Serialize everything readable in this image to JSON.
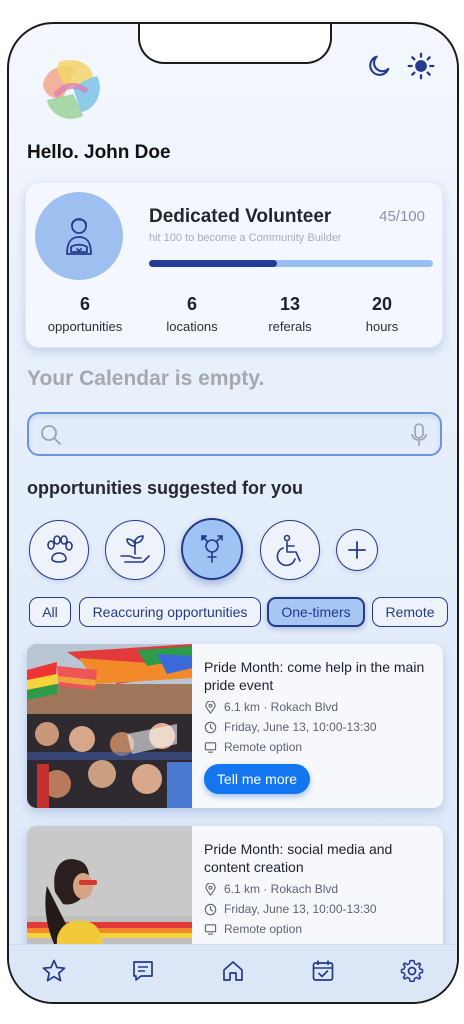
{
  "greeting": "Hello. John Doe",
  "profile": {
    "level_title": "Dedicated Volunteer",
    "points": "45/100",
    "next_level_hint": "hit 100 to become a Community Builder",
    "progress_fraction": 0.45,
    "avatar_icon": "volunteer-person-icon"
  },
  "stats": [
    {
      "value": "6",
      "label": "opportunities"
    },
    {
      "value": "6",
      "label": "locations"
    },
    {
      "value": "13",
      "label": "referals"
    },
    {
      "value": "20",
      "label": "hours"
    }
  ],
  "calendar_message": "Your Calendar is empty.",
  "search": {
    "placeholder": "",
    "value": ""
  },
  "suggested_title": "opportunities suggested for you",
  "categories": [
    {
      "icon": "paw-icon",
      "active": false
    },
    {
      "icon": "plant-hand-icon",
      "active": false
    },
    {
      "icon": "gender-symbol-icon",
      "active": true
    },
    {
      "icon": "accessibility-icon",
      "active": false
    },
    {
      "icon": "plus-icon",
      "active": false
    }
  ],
  "filters": [
    {
      "label": "All",
      "active": false
    },
    {
      "label": "Reaccuring opportunities",
      "active": false
    },
    {
      "label": "One-timers",
      "active": true
    },
    {
      "label": "Remote",
      "active": false
    }
  ],
  "opportunities": [
    {
      "title": "Pride Month: come help in the main pride event",
      "distance": "6.1 km · Rokach Blvd",
      "date": "Friday, June 13, 10:00-13:30",
      "remote": "Remote option",
      "cta": "Tell me more"
    },
    {
      "title": "Pride Month: social media and content creation",
      "distance": "6.1 km · Rokach Blvd",
      "date": "Friday, June 13, 10:00-13:30",
      "remote": "Remote option"
    }
  ],
  "nav": [
    {
      "icon": "star-icon"
    },
    {
      "icon": "chat-icon"
    },
    {
      "icon": "home-icon"
    },
    {
      "icon": "calendar-check-icon"
    },
    {
      "icon": "gear-icon"
    }
  ],
  "colors": {
    "accent": "#1475f0",
    "navy": "#243a8c",
    "light_blue": "#9fc3f2"
  }
}
